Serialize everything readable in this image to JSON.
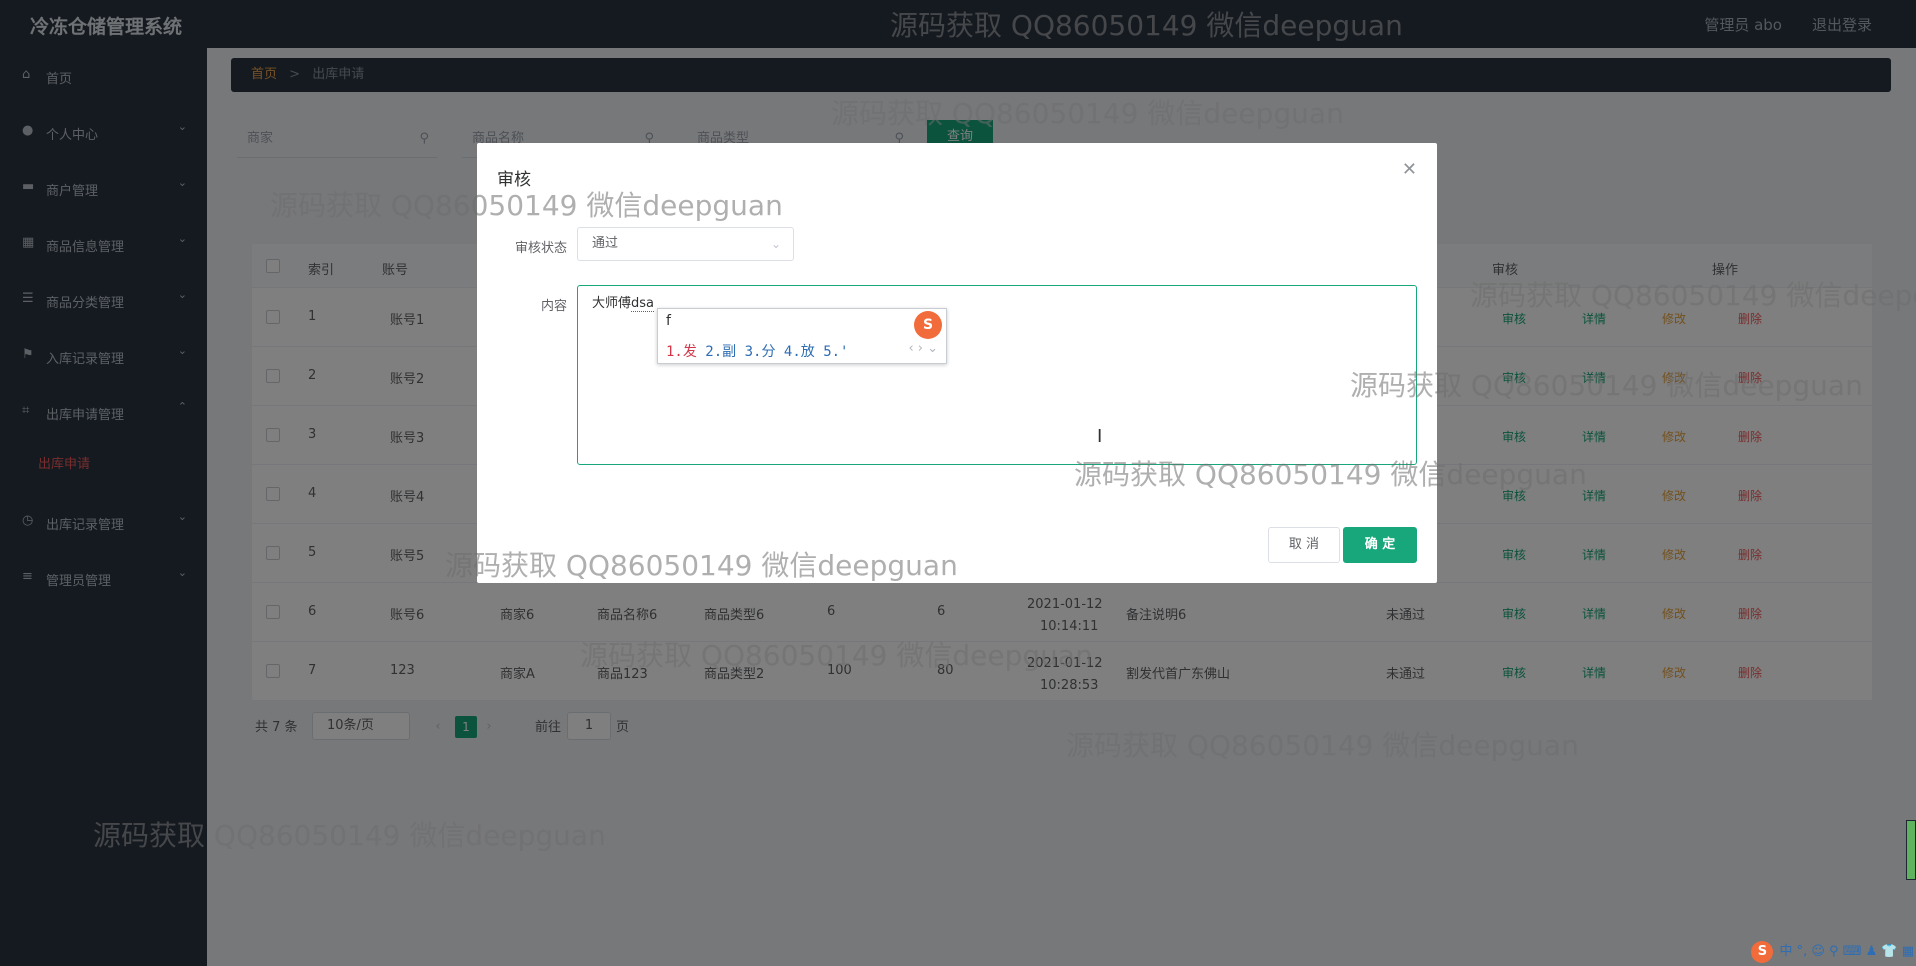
{
  "header": {
    "title": "冷冻仓储管理系统",
    "user": "管理员 abo",
    "logout": "退出登录"
  },
  "sidebar": {
    "items": [
      {
        "label": "首页",
        "icon": "home-icon"
      },
      {
        "label": "个人中心",
        "icon": "user-icon"
      },
      {
        "label": "商户管理",
        "icon": "monitor-icon"
      },
      {
        "label": "商品信息管理",
        "icon": "grid-icon"
      },
      {
        "label": "商品分类管理",
        "icon": "sliders-icon"
      },
      {
        "label": "入库记录管理",
        "icon": "flag-icon"
      },
      {
        "label": "出库申请管理",
        "icon": "crop-icon"
      },
      {
        "label": "出库记录管理",
        "icon": "clock-icon"
      },
      {
        "label": "管理员管理",
        "icon": "list-icon"
      }
    ],
    "active_sub": "出库申请"
  },
  "breadcrumb": {
    "home": "首页",
    "sep": ">",
    "current": "出库申请"
  },
  "filters": {
    "merchant": "商家",
    "product_name": "商品名称",
    "product_type": "商品类型",
    "query": "查询"
  },
  "table": {
    "headers": {
      "index": "索引",
      "account": "账号",
      "audit": "审核",
      "ops": "操作"
    },
    "rows": [
      {
        "idx": "1",
        "account": "账号1",
        "merchant": "",
        "name": "",
        "type": "",
        "q1": "",
        "q2": "",
        "time1": "",
        "time2": "",
        "note": "",
        "status": ""
      },
      {
        "idx": "2",
        "account": "账号2",
        "merchant": "",
        "name": "",
        "type": "",
        "q1": "",
        "q2": "",
        "time1": "",
        "time2": "",
        "note": "",
        "status": ""
      },
      {
        "idx": "3",
        "account": "账号3",
        "merchant": "",
        "name": "",
        "type": "",
        "q1": "",
        "q2": "",
        "time1": "",
        "time2": "",
        "note": "",
        "status": ""
      },
      {
        "idx": "4",
        "account": "账号4",
        "merchant": "",
        "name": "",
        "type": "",
        "q1": "",
        "q2": "",
        "time1": "",
        "time2": "",
        "note": "",
        "status": ""
      },
      {
        "idx": "5",
        "account": "账号5",
        "merchant": "",
        "name": "",
        "type": "",
        "q1": "",
        "q2": "",
        "time1": "",
        "time2": "",
        "note": "",
        "status": ""
      },
      {
        "idx": "6",
        "account": "账号6",
        "merchant": "商家6",
        "name": "商品名称6",
        "type": "商品类型6",
        "q1": "6",
        "q2": "6",
        "time1": "2021-01-12",
        "time2": "10:14:11",
        "note": "备注说明6",
        "status": "未通过"
      },
      {
        "idx": "7",
        "account": "123",
        "merchant": "商家A",
        "name": "商品123",
        "type": "商品类型2",
        "q1": "100",
        "q2": "80",
        "time1": "2021-01-12",
        "time2": "10:28:53",
        "note": "割发代首广东佛山",
        "status": "未通过"
      }
    ],
    "actions": {
      "audit": "审核",
      "detail": "详情",
      "edit": "修改",
      "delete": "删除"
    }
  },
  "pagination": {
    "total": "共 7 条",
    "page_size": "10条/页",
    "current": "1",
    "goto": "前往",
    "goto_value": "1",
    "page_unit": "页"
  },
  "dialog": {
    "title": "审核",
    "status_label": "审核状态",
    "status_value": "通过",
    "content_label": "内容",
    "content_text": "大师傅",
    "content_composing": "dsa",
    "cancel": "取 消",
    "confirm": "确 定"
  },
  "ime": {
    "input": "f",
    "candidates": [
      "1.发",
      "2.副",
      "3.分",
      "4.放",
      "5.'"
    ],
    "logo": "S"
  },
  "watermark": "源码获取 QQ86050149 微信deepguan",
  "taskbar": {
    "logo": "S",
    "text": "中 °, ☺ ⚲ ⌨ ♟ 👕 ▦"
  }
}
